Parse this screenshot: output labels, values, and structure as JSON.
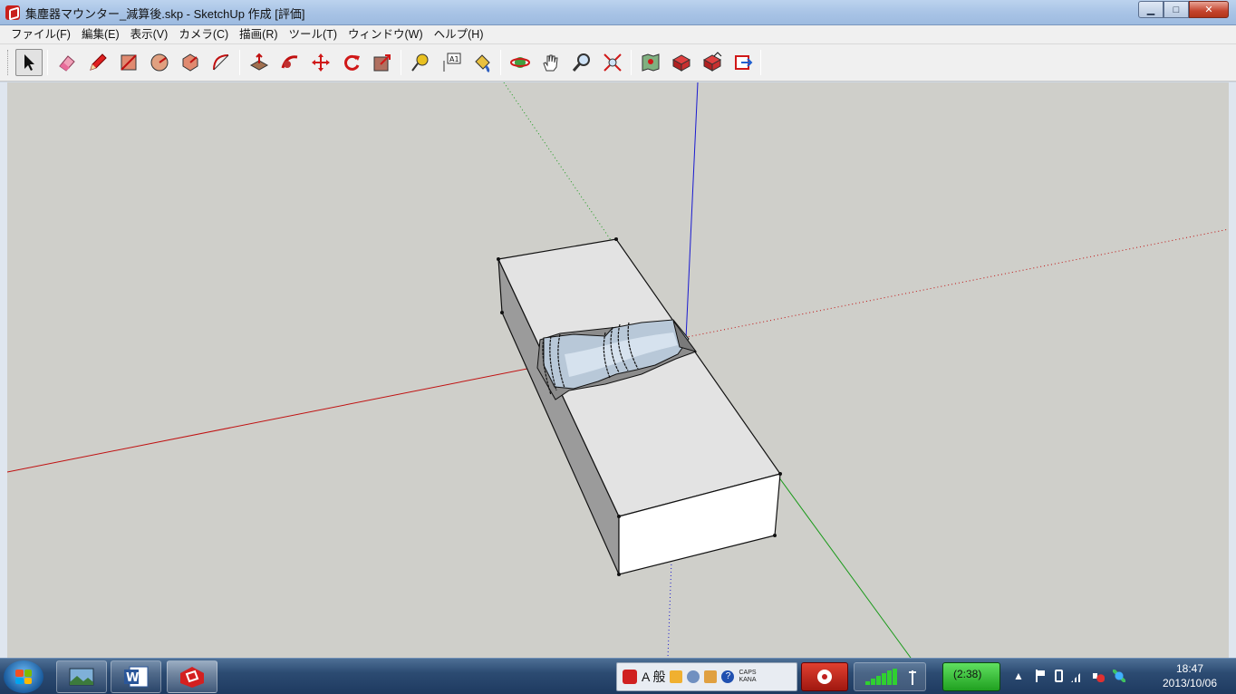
{
  "window": {
    "title": "集塵器マウンター_減算後.skp - SketchUp 作成 [評価]",
    "minimize_glyph": "▁",
    "maximize_glyph": "□",
    "close_glyph": "✕"
  },
  "menu": [
    {
      "label": "ファイル(F)"
    },
    {
      "label": "編集(E)"
    },
    {
      "label": "表示(V)"
    },
    {
      "label": "カメラ(C)"
    },
    {
      "label": "描画(R)"
    },
    {
      "label": "ツール(T)"
    },
    {
      "label": "ウィンドウ(W)"
    },
    {
      "label": "ヘルプ(H)"
    }
  ],
  "toolbar": {
    "tools": [
      {
        "name": "select-tool",
        "icon": "arrow-icon",
        "active": true
      },
      {
        "name": "eraser-tool",
        "icon": "eraser-icon"
      },
      {
        "name": "pencil-tool",
        "icon": "pencil-icon"
      },
      {
        "name": "rectangle-tool",
        "icon": "rectangle-icon"
      },
      {
        "name": "circle-tool",
        "icon": "circle-icon"
      },
      {
        "name": "polygon-tool",
        "icon": "polygon-icon"
      },
      {
        "name": "arc-tool",
        "icon": "arc-icon"
      },
      {
        "name": "push-pull-tool",
        "icon": "push-pull-icon"
      },
      {
        "name": "follow-me-tool",
        "icon": "follow-me-icon"
      },
      {
        "name": "move-tool",
        "icon": "move-icon"
      },
      {
        "name": "rotate-tool",
        "icon": "rotate-icon"
      },
      {
        "name": "scale-tool",
        "icon": "scale-icon"
      },
      {
        "name": "tape-measure-tool",
        "icon": "tape-measure-icon"
      },
      {
        "name": "text-tool",
        "icon": "text-icon",
        "label": "A1"
      },
      {
        "name": "paint-bucket-tool",
        "icon": "paint-bucket-icon"
      },
      {
        "name": "orbit-tool",
        "icon": "orbit-icon"
      },
      {
        "name": "pan-tool",
        "icon": "hand-icon"
      },
      {
        "name": "zoom-tool",
        "icon": "magnifier-icon"
      },
      {
        "name": "zoom-extents-tool",
        "icon": "zoom-extents-icon"
      },
      {
        "name": "map-tool",
        "icon": "map-icon"
      },
      {
        "name": "warehouse-get-tool",
        "icon": "warehouse-icon"
      },
      {
        "name": "warehouse-share-tool",
        "icon": "warehouse-share-icon"
      },
      {
        "name": "extension-warehouse-tool",
        "icon": "extension-icon"
      }
    ]
  },
  "colors": {
    "viewport_bg": "#cfcfca",
    "red_axis": "#c01010",
    "green_axis": "#1a9a1a",
    "blue_axis": "#1a1ad0",
    "box_top": "#e3e3e3",
    "box_left": "#9b9b9b",
    "box_front": "#ffffff",
    "part_steel": "#b8c8d8"
  },
  "taskbar": {
    "ime_mode": "A 般",
    "caps": "CAPS",
    "kana": "KANA",
    "battery_time": "(2:38)",
    "clock_time": "18:47",
    "clock_date": "2013/10/06"
  }
}
